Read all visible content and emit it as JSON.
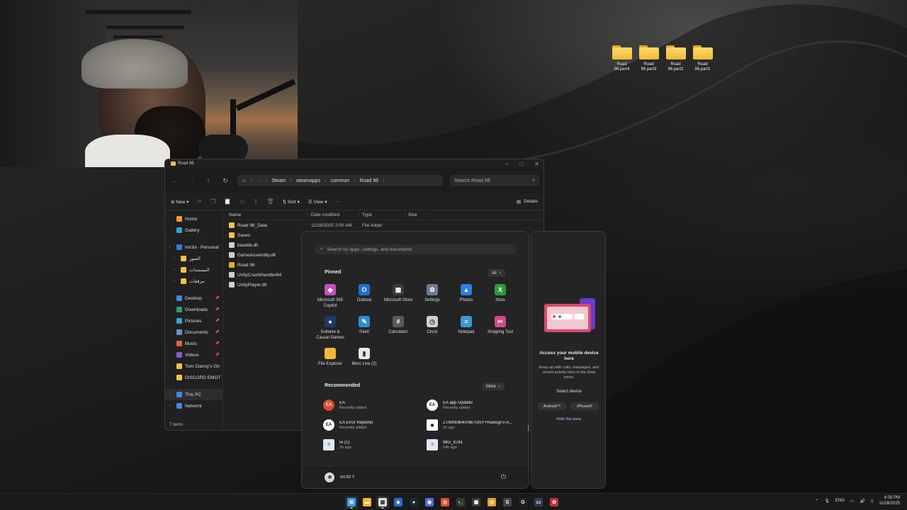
{
  "desktop": {
    "icons": [
      {
        "label": "Road 96.part4"
      },
      {
        "label": "Road 96.part3"
      },
      {
        "label": "Road 96.part2"
      },
      {
        "label": "Road 96.part1"
      }
    ]
  },
  "explorer": {
    "tab_title": "Road 96",
    "breadcrumb": [
      "Steam",
      "steamapps",
      "common",
      "Road 96"
    ],
    "search_placeholder": "Search Road 96",
    "toolbar": {
      "new": "New",
      "sort": "Sort",
      "view": "View",
      "more": "···",
      "details": "Details"
    },
    "sidebar": [
      {
        "label": "Home",
        "icon": "home-icon",
        "color": "#f0a030"
      },
      {
        "label": "Gallery",
        "icon": "gallery-icon",
        "color": "#3b9de0"
      },
      {
        "label": "imr3d - Personal",
        "icon": "onedrive-icon",
        "color": "#2f7fd6"
      },
      {
        "label": "الصور",
        "icon": "folder-icon",
        "color": "#f2c14e"
      },
      {
        "label": "المستندات",
        "icon": "folder-icon",
        "color": "#f2c14e"
      },
      {
        "label": "مرفقات",
        "icon": "folder-icon",
        "color": "#f2c14e"
      },
      {
        "label": "Desktop",
        "icon": "desktop-icon",
        "color": "#3b8ed8"
      },
      {
        "label": "Downloads",
        "icon": "downloads-icon",
        "color": "#2aa06a"
      },
      {
        "label": "Pictures",
        "icon": "pictures-icon",
        "color": "#3b9de0"
      },
      {
        "label": "Documents",
        "icon": "documents-icon",
        "color": "#6a8fc8"
      },
      {
        "label": "Music",
        "icon": "music-icon",
        "color": "#e0604a"
      },
      {
        "label": "Videos",
        "icon": "videos-icon",
        "color": "#8a5ad6"
      },
      {
        "label": "Tom Clancy's Gh",
        "icon": "folder-icon",
        "color": "#f2c14e"
      },
      {
        "label": "DISCORD EMOT",
        "icon": "folder-icon",
        "color": "#f2c14e"
      },
      {
        "label": "This PC",
        "icon": "pc-icon",
        "color": "#3b8ed8"
      },
      {
        "label": "Network",
        "icon": "network-icon",
        "color": "#3b8ed8"
      }
    ],
    "columns": {
      "name": "Name",
      "date": "Date modified",
      "type": "Type",
      "size": "Size"
    },
    "files": [
      {
        "name": "Road 96_Data",
        "date": "11/28/2025 2:00 AM",
        "type": "File folder",
        "icon": "folder-icon",
        "color": "#f2c14e"
      },
      {
        "name": "Saves",
        "date": "",
        "type": "",
        "icon": "folder-icon",
        "color": "#f2c14e"
      },
      {
        "name": "baselib.dll",
        "date": "",
        "type": "",
        "icon": "dll-icon",
        "color": "#cfcfcf"
      },
      {
        "name": "GameAssembly.dll",
        "date": "",
        "type": "",
        "icon": "dll-icon",
        "color": "#cfcfcf"
      },
      {
        "name": "Road 96",
        "date": "",
        "type": "",
        "icon": "road96-app-icon",
        "color": "#e0b030"
      },
      {
        "name": "UnityCrashHandler64",
        "date": "",
        "type": "",
        "icon": "unity-icon",
        "color": "#cfcfcf"
      },
      {
        "name": "UnityPlayer.dll",
        "date": "",
        "type": "",
        "icon": "dll-icon",
        "color": "#cfcfcf"
      }
    ],
    "status": "7 items"
  },
  "start_menu": {
    "search_placeholder": "Search for apps, settings, and documents",
    "pinned_title": "Pinned",
    "all_label": "All",
    "pinned": [
      {
        "label": "Microsoft 365\nCopilot",
        "icon": "m365-copilot-icon",
        "color": "#c44fbf",
        "glyph": "◆"
      },
      {
        "label": "Outlook",
        "icon": "outlook-icon",
        "color": "#1f6fd1",
        "glyph": "O"
      },
      {
        "label": "Microsoft Store",
        "icon": "store-icon",
        "color": "#3a3a3a",
        "glyph": "▦"
      },
      {
        "label": "Settings",
        "icon": "settings-icon",
        "color": "#6b7a90",
        "glyph": "⚙"
      },
      {
        "label": "Photos",
        "icon": "photos-icon",
        "color": "#2b7fe0",
        "glyph": "▲"
      },
      {
        "label": "Xbox",
        "icon": "xbox-icon",
        "color": "#2a9a3a",
        "glyph": "X"
      },
      {
        "label": "Solitaire &\nCasual Games",
        "icon": "solitaire-icon",
        "color": "#1b3a6a",
        "glyph": "♠"
      },
      {
        "label": "Paint",
        "icon": "paint-icon",
        "color": "#2c8fd0",
        "glyph": "✎"
      },
      {
        "label": "Calculator",
        "icon": "calculator-icon",
        "color": "#5a5a5a",
        "glyph": "#"
      },
      {
        "label": "Clock",
        "icon": "clock-icon",
        "color": "#d0d0d0",
        "glyph": "◷"
      },
      {
        "label": "Notepad",
        "icon": "notepad-icon",
        "color": "#3a9ad8",
        "glyph": "≡"
      },
      {
        "label": "Snipping Tool",
        "icon": "snipping-tool-icon",
        "color": "#d04a8a",
        "glyph": "✂"
      },
      {
        "label": "File Explorer",
        "icon": "file-explorer-icon",
        "color": "#f2b938",
        "glyph": ""
      },
      {
        "label": "Merc Live (2)",
        "icon": "merc-live-icon",
        "color": "#e8e8e8",
        "glyph": "▮"
      }
    ],
    "recommended_title": "Recommended",
    "more_label": "More",
    "recommended": [
      {
        "name": "EA",
        "time": "Recently added",
        "icon": "ea-icon",
        "color": "#e04a2a",
        "glyph": "EA"
      },
      {
        "name": "EA app Updater",
        "time": "Recently added",
        "icon": "ea-updater-icon",
        "color": "#ffffff",
        "glyph": "EA"
      },
      {
        "name": "EA Error Reporter",
        "time": "Recently added",
        "icon": "ea-error-reporter-icon",
        "color": "#ffffff",
        "glyph": "EA"
      },
      {
        "name": "ZTrktN0lk4lXN67UI5Y+RawsgFv-A...",
        "time": "1h ago",
        "icon": "image-file-icon",
        "color": "#ffffff",
        "glyph": "◉"
      },
      {
        "name": "re (1)",
        "time": "2h ago",
        "icon": "document-file-icon",
        "color": "#dfe8f5",
        "glyph": "≡"
      },
      {
        "name": "IMG_8781",
        "time": "14h ago",
        "icon": "image-file-icon",
        "color": "#dfe8f5",
        "glyph": "≡"
      }
    ],
    "user_name": "imr3d Y"
  },
  "phone_pane": {
    "title": "Access your mobile device here",
    "body": "Keep up with calls, messages, and recent activity here in the Start menu.",
    "select_label": "Select device",
    "android_label": "Android™",
    "iphone_label": "iPhone®",
    "hide_label": "Hide this pane"
  },
  "taskbar": {
    "apps": [
      {
        "icon": "start-icon",
        "color": "#3aa0f0",
        "glyph": "⊞",
        "active": true
      },
      {
        "icon": "file-explorer-icon",
        "color": "#f2b938",
        "glyph": "▬",
        "active": false
      },
      {
        "icon": "calendar-icon",
        "color": "#dddddd",
        "glyph": "▦",
        "active": true
      },
      {
        "icon": "vpn-icon",
        "color": "#2a6ad0",
        "glyph": "◈",
        "active": false
      },
      {
        "icon": "steam-icon",
        "color": "#1b2838",
        "glyph": "●",
        "active": false
      },
      {
        "icon": "discord-icon",
        "color": "#5865f2",
        "glyph": "◉",
        "active": false
      },
      {
        "icon": "chrome-icon",
        "color": "#e04a2a",
        "glyph": "◎",
        "active": false
      },
      {
        "icon": "terminal-icon",
        "color": "#2f3b2f",
        "glyph": "›_",
        "active": false
      },
      {
        "icon": "store-icon",
        "color": "#3a3a3a",
        "glyph": "▦",
        "active": false
      },
      {
        "icon": "chrome-alt-icon",
        "color": "#e0a02a",
        "glyph": "◎",
        "active": false
      },
      {
        "icon": "editor-icon",
        "color": "#444444",
        "glyph": "S",
        "active": false
      },
      {
        "icon": "logitech-icon",
        "color": "#222222",
        "glyph": "G",
        "active": false
      },
      {
        "icon": "media-icon",
        "color": "#333a55",
        "glyph": "▭",
        "active": false
      },
      {
        "icon": "game-icon",
        "color": "#c03040",
        "glyph": "✿",
        "active": false
      }
    ],
    "language": "ENG",
    "time": "4:09 PM",
    "date": "11/28/2025"
  }
}
